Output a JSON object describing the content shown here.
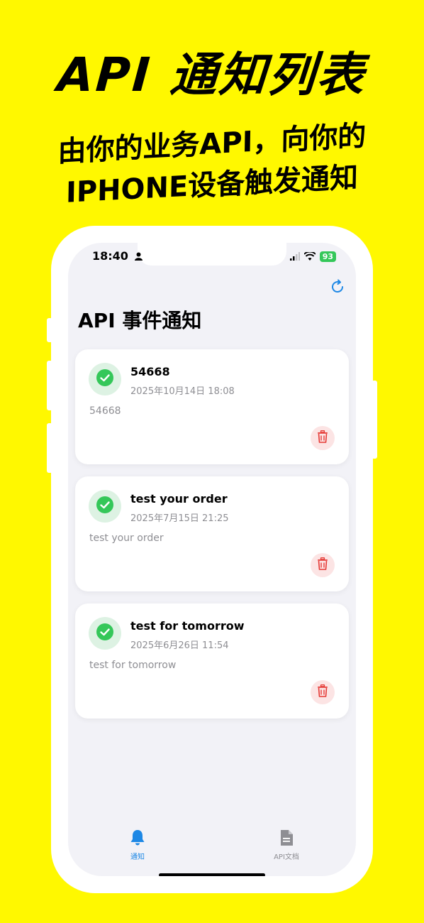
{
  "promo": {
    "headline": "API 通知列表",
    "subline1": "由你的业务API，向你的",
    "subline2": "IPHONE设备触发通知"
  },
  "status_bar": {
    "time": "18:40",
    "battery": "93"
  },
  "header": {
    "title": "API 事件通知"
  },
  "notifications": [
    {
      "title": "54668",
      "date": "2025年10月14日 18:08",
      "body": "54668"
    },
    {
      "title": "test your order",
      "date": "2025年7月15日 21:25",
      "body": "test your order"
    },
    {
      "title": "test for tomorrow",
      "date": "2025年6月26日 11:54",
      "body": "test for tomorrow"
    }
  ],
  "tab_bar": {
    "tabs": [
      {
        "label": "通知",
        "icon": "bell-icon",
        "active": true
      },
      {
        "label": "API文档",
        "icon": "document-icon",
        "active": false
      }
    ]
  },
  "colors": {
    "background": "#FFF800",
    "accent": "#1E88E5",
    "success": "#34C759",
    "destructive": "#E53935"
  }
}
